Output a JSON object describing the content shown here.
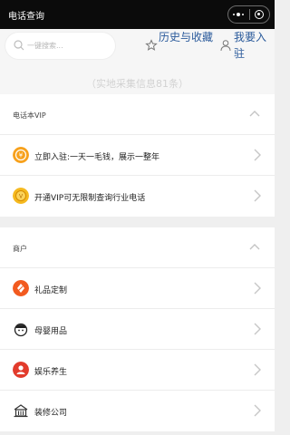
{
  "nav": {
    "title": "电话查询"
  },
  "search": {
    "placeholder": "一键搜索..."
  },
  "actions": {
    "favorites": "历史与收藏",
    "join": "我要入驻"
  },
  "info_count": "（实地采集信息81条）",
  "vip_section": {
    "title": "电话本VIP",
    "items": [
      {
        "label": "立即入驻:一天一毛钱，展示一整年",
        "icon": "coin-icon",
        "color": "#f7a11c"
      },
      {
        "label": "开通VIP可无限制查询行业电话",
        "icon": "vip-coin-icon",
        "color": "#f5b91f"
      }
    ]
  },
  "merchant_section": {
    "title": "商户",
    "items": [
      {
        "label": "礼品定制",
        "icon": "gift-icon",
        "color": "#f25a1f"
      },
      {
        "label": "母婴用品",
        "icon": "baby-icon",
        "color": "#222222"
      },
      {
        "label": "娱乐养生",
        "icon": "massage-icon",
        "color": "#e23b2c"
      },
      {
        "label": "装修公司",
        "icon": "building-icon",
        "color": "#333333"
      }
    ]
  }
}
